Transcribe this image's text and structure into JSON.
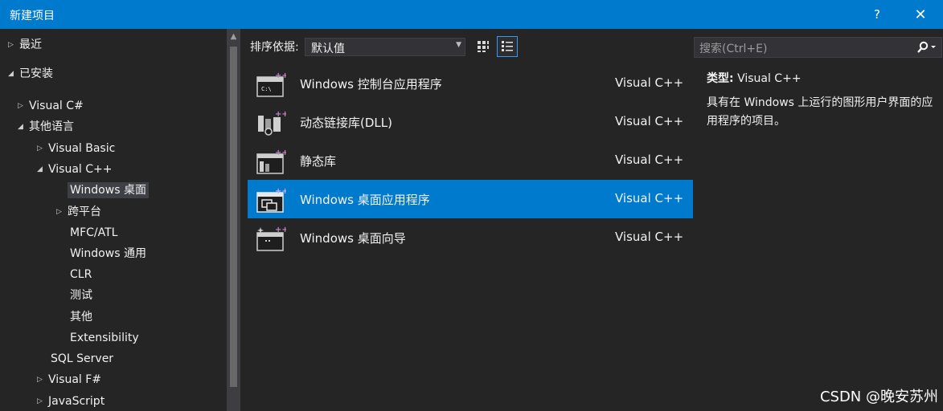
{
  "window": {
    "title": "新建项目",
    "help_label": "?",
    "close_label": "✕"
  },
  "tree": {
    "items": [
      {
        "label": "最近",
        "arrow": "▷"
      },
      {
        "label": "已安装",
        "arrow": "◢"
      },
      {
        "label": "Visual C#",
        "arrow": "▷"
      },
      {
        "label": "其他语言",
        "arrow": "◢"
      },
      {
        "label": "Visual Basic",
        "arrow": "▷"
      },
      {
        "label": "Visual C++",
        "arrow": "◢"
      },
      {
        "label": "Windows 桌面",
        "arrow": ""
      },
      {
        "label": "跨平台",
        "arrow": "▷"
      },
      {
        "label": "MFC/ATL",
        "arrow": ""
      },
      {
        "label": "Windows 通用",
        "arrow": ""
      },
      {
        "label": "CLR",
        "arrow": ""
      },
      {
        "label": "测试",
        "arrow": ""
      },
      {
        "label": "其他",
        "arrow": ""
      },
      {
        "label": "Extensibility",
        "arrow": ""
      },
      {
        "label": "SQL Server",
        "arrow": ""
      },
      {
        "label": "Visual F#",
        "arrow": "▷"
      },
      {
        "label": "JavaScript",
        "arrow": "▷"
      }
    ],
    "selected": "Windows 桌面"
  },
  "sort": {
    "label": "排序依据:",
    "value": "默认值"
  },
  "templates": [
    {
      "name": "Windows 控制台应用程序",
      "language": "Visual C++",
      "icon": "console-app-icon"
    },
    {
      "name": "动态链接库(DLL)",
      "language": "Visual C++",
      "icon": "dll-icon"
    },
    {
      "name": "静态库",
      "language": "Visual C++",
      "icon": "static-library-icon"
    },
    {
      "name": "Windows 桌面应用程序",
      "language": "Visual C++",
      "icon": "desktop-app-icon",
      "selected": true
    },
    {
      "name": "Windows 桌面向导",
      "language": "Visual C++",
      "icon": "desktop-wizard-icon"
    }
  ],
  "details": {
    "search_placeholder": "搜索(Ctrl+E)",
    "type_key": "类型:",
    "type_value": "Visual C++",
    "description": "具有在 Windows 上运行的图形用户界面的应用程序的项目。"
  },
  "watermark": "CSDN @晚安苏州",
  "colors": {
    "accent": "#007acc",
    "background": "#252526",
    "plus_badge": "#c586c0"
  }
}
